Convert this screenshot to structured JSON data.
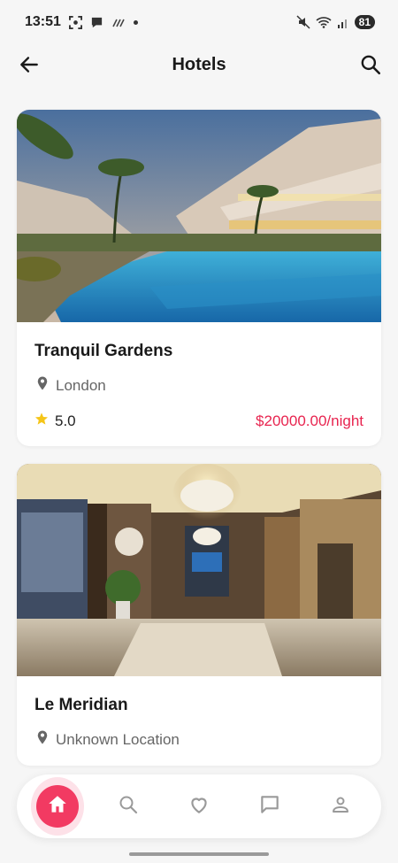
{
  "status_bar": {
    "time": "13:51",
    "battery": "81",
    "icons": [
      "screenshot-icon",
      "chat-bubble-icon",
      "signal-strength-icon",
      "notification-dot",
      "mute-icon",
      "wifi-icon",
      "cell-signal-icon",
      "battery-icon"
    ]
  },
  "app_bar": {
    "title": "Hotels",
    "back_icon": "arrow-left-icon",
    "search_icon": "search-icon"
  },
  "hotels": [
    {
      "name": "Tranquil Gardens",
      "location": "London",
      "rating": "5.0",
      "price": "$20000.00/night",
      "image": "resort-pool-photo"
    },
    {
      "name": "Le Meridian",
      "location": "Unknown Location",
      "rating": "",
      "price": "",
      "image": "hotel-lobby-photo"
    }
  ],
  "bottom_nav": {
    "items": [
      "home-icon",
      "search-icon",
      "heart-icon",
      "chat-icon",
      "profile-icon"
    ],
    "active": "home-icon"
  },
  "colors": {
    "accent": "#f23a62",
    "price": "#e8244f",
    "star": "#f5c518",
    "background": "#f6f6f6"
  }
}
